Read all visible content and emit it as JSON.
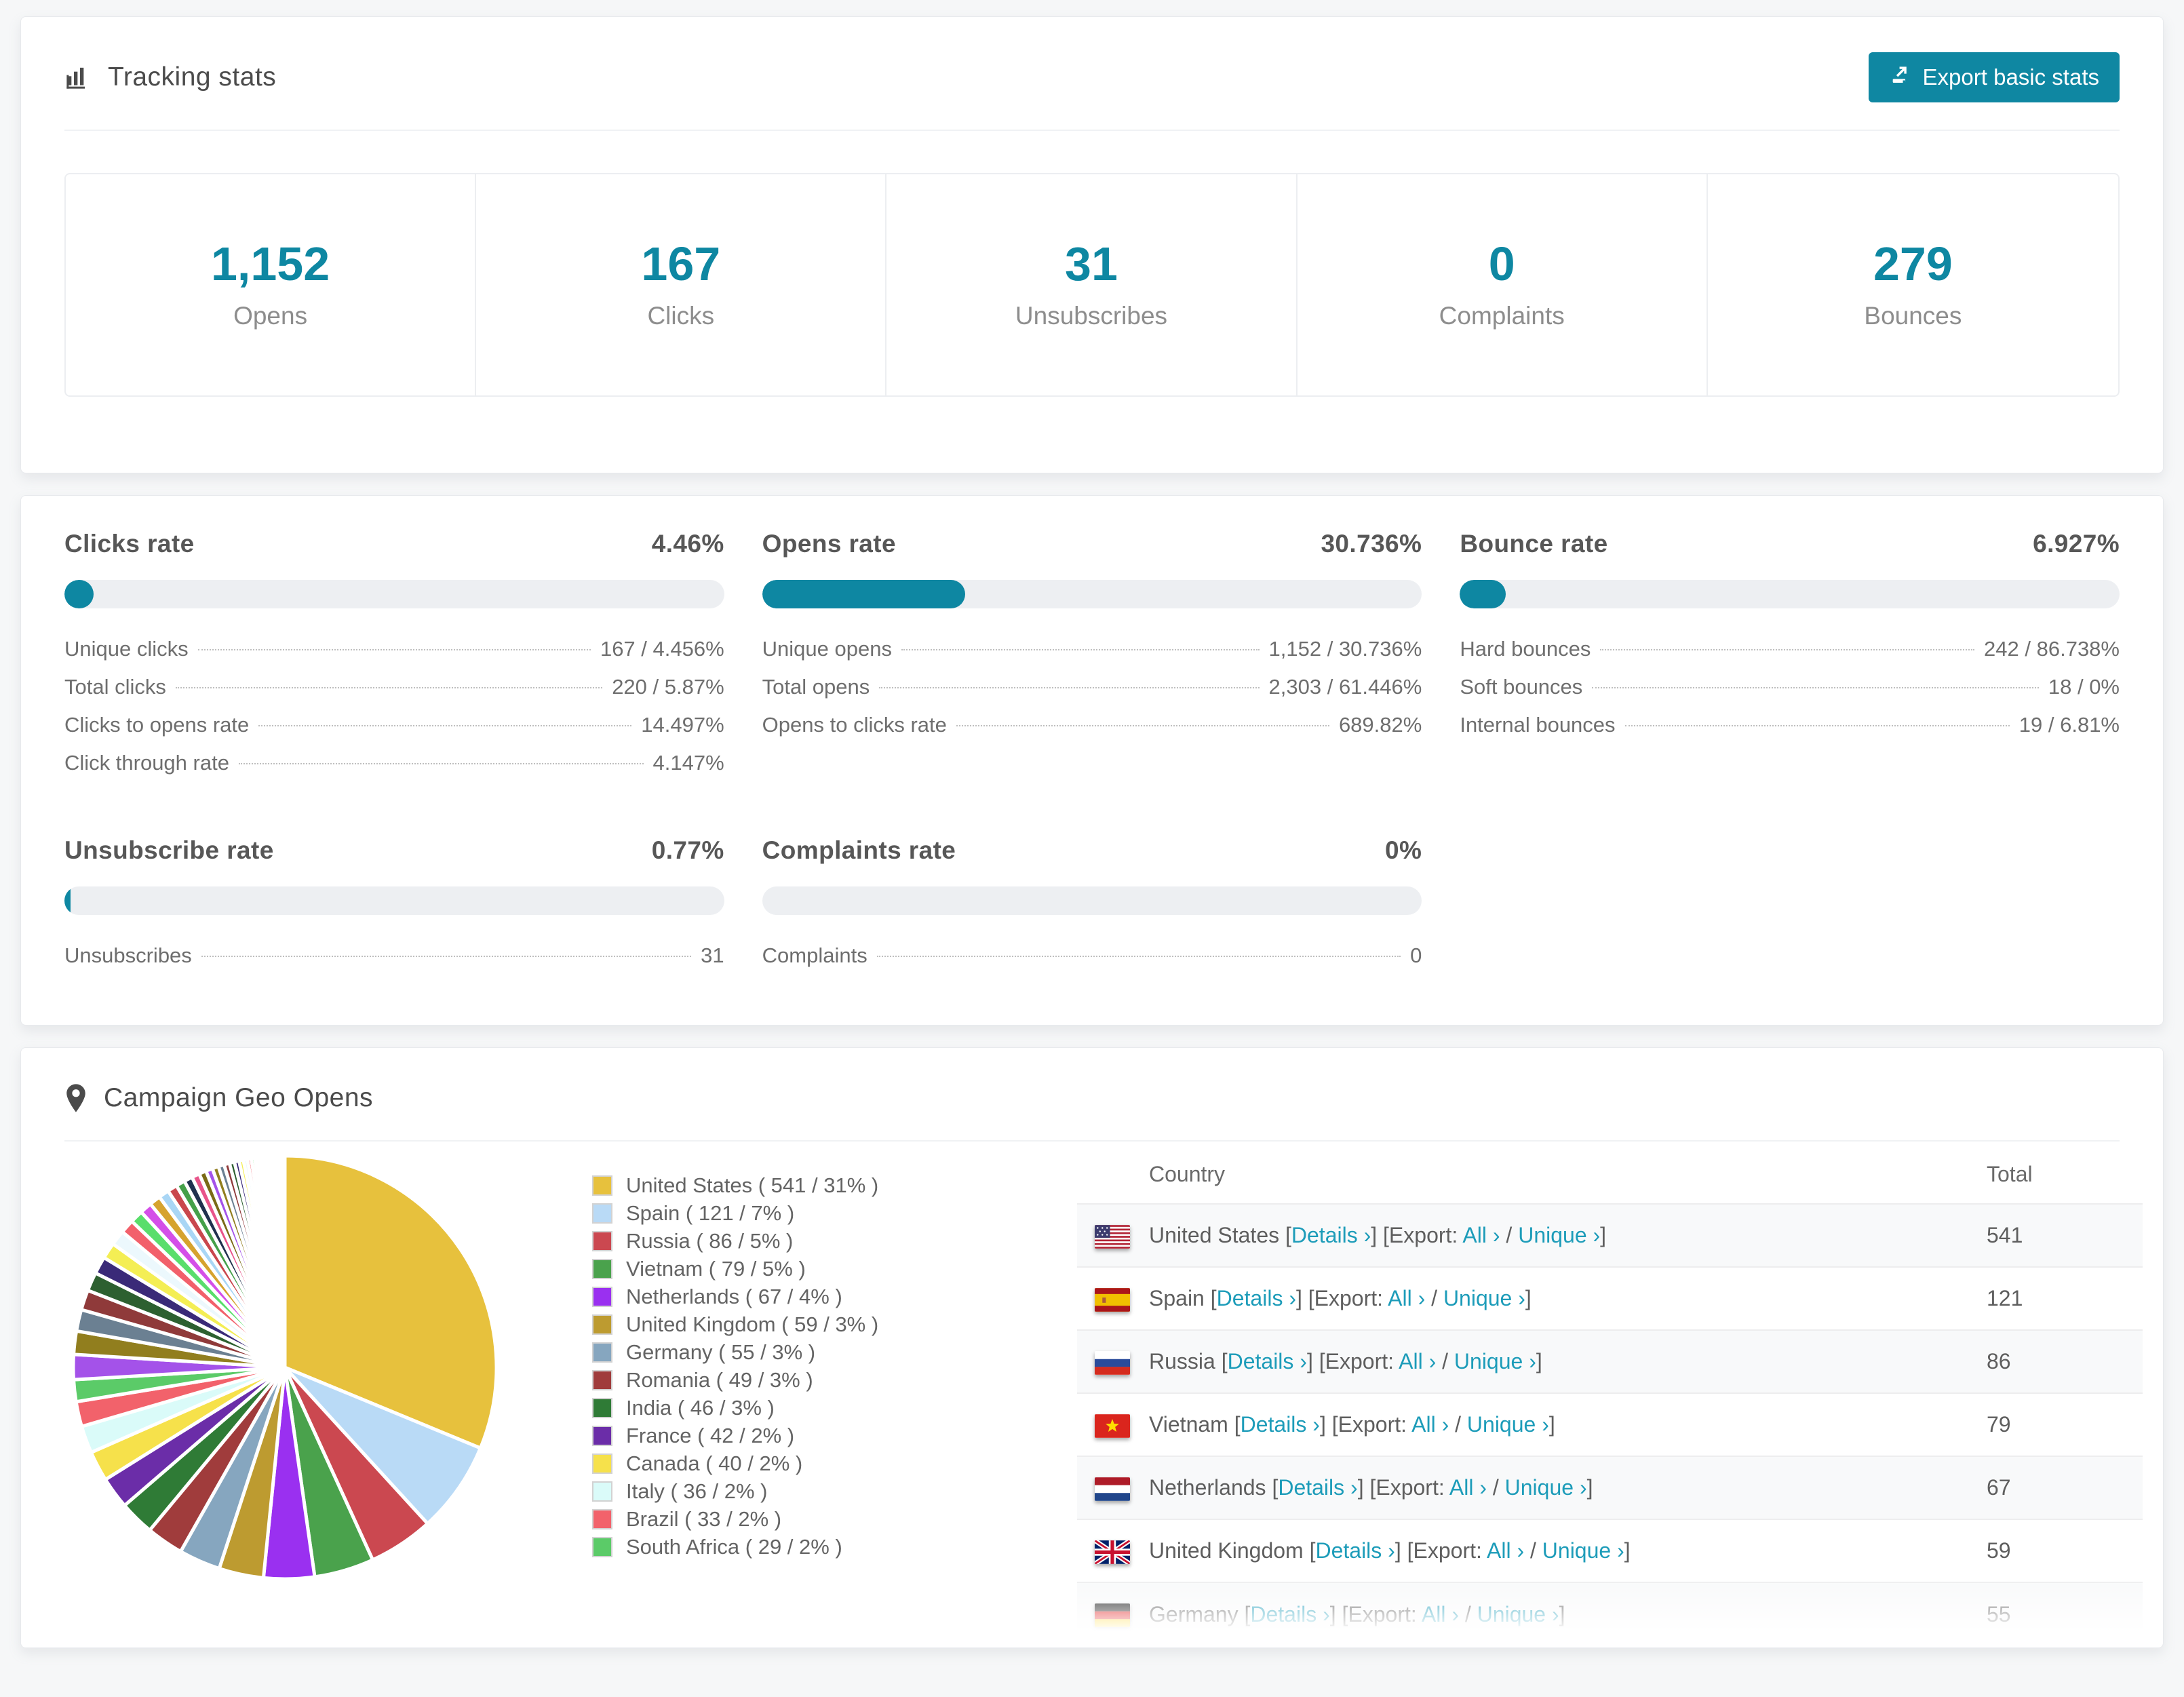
{
  "colors": {
    "accent": "#0e87a2",
    "link": "#1d9cb9"
  },
  "tracking": {
    "title": "Tracking stats",
    "export_button": "Export basic stats",
    "summary": [
      {
        "value": "1,152",
        "label": "Opens"
      },
      {
        "value": "167",
        "label": "Clicks"
      },
      {
        "value": "31",
        "label": "Unsubscribes"
      },
      {
        "value": "0",
        "label": "Complaints"
      },
      {
        "value": "279",
        "label": "Bounces"
      }
    ]
  },
  "rates": [
    {
      "title": "Clicks rate",
      "value": "4.46%",
      "percent": 4.46,
      "rows": [
        {
          "label": "Unique clicks",
          "value": "167 / 4.456%"
        },
        {
          "label": "Total clicks",
          "value": "220 / 5.87%"
        },
        {
          "label": "Clicks to opens rate",
          "value": "14.497%"
        },
        {
          "label": "Click through rate",
          "value": "4.147%"
        }
      ]
    },
    {
      "title": "Opens rate",
      "value": "30.736%",
      "percent": 30.736,
      "rows": [
        {
          "label": "Unique opens",
          "value": "1,152 / 30.736%"
        },
        {
          "label": "Total opens",
          "value": "2,303 / 61.446%"
        },
        {
          "label": "Opens to clicks rate",
          "value": "689.82%"
        }
      ]
    },
    {
      "title": "Bounce rate",
      "value": "6.927%",
      "percent": 6.927,
      "rows": [
        {
          "label": "Hard bounces",
          "value": "242 / 86.738%"
        },
        {
          "label": "Soft bounces",
          "value": "18 / 0%"
        },
        {
          "label": "Internal bounces",
          "value": "19 / 6.81%"
        }
      ]
    },
    {
      "title": "Unsubscribe rate",
      "value": "0.77%",
      "percent": 0.77,
      "rows": [
        {
          "label": "Unsubscribes",
          "value": "31"
        }
      ]
    },
    {
      "title": "Complaints rate",
      "value": "0%",
      "percent": 0,
      "rows": [
        {
          "label": "Complaints",
          "value": "0"
        }
      ]
    }
  ],
  "geo": {
    "title": "Campaign Geo Opens",
    "legend": [
      {
        "label": "United States ( 541 / 31% )",
        "color": "#e7c13d"
      },
      {
        "label": "Spain ( 121 / 7% )",
        "color": "#b9daf6"
      },
      {
        "label": "Russia ( 86 / 5% )",
        "color": "#cb4850"
      },
      {
        "label": "Vietnam ( 79 / 5% )",
        "color": "#4aa24c"
      },
      {
        "label": "Netherlands ( 67 / 4% )",
        "color": "#9a30f0"
      },
      {
        "label": "United Kingdom ( 59 / 3% )",
        "color": "#bd9b30"
      },
      {
        "label": "Germany ( 55 / 3% )",
        "color": "#86a6bf"
      },
      {
        "label": "Romania ( 49 / 3% )",
        "color": "#a03c3c"
      },
      {
        "label": "India ( 46 / 3% )",
        "color": "#2f7b36"
      },
      {
        "label": "France ( 42 / 2% )",
        "color": "#6b2da8"
      },
      {
        "label": "Canada ( 40 / 2% )",
        "color": "#f6e14b"
      },
      {
        "label": "Italy ( 36 / 2% )",
        "color": "#dafbf9"
      },
      {
        "label": "Brazil ( 33 / 2% )",
        "color": "#f2626b"
      },
      {
        "label": "South Africa ( 29 / 2% )",
        "color": "#5bcb68"
      }
    ],
    "table": {
      "headers": {
        "country": "Country",
        "total": "Total"
      },
      "links": {
        "bracket_open": "[",
        "bracket_close": "]",
        "details": "Details ›",
        "export_prefix": "[Export:",
        "all": "All ›",
        "separator": "/",
        "unique": "Unique ›"
      },
      "rows": [
        {
          "flag": "us",
          "country": "United States",
          "total": "541"
        },
        {
          "flag": "es",
          "country": "Spain",
          "total": "121"
        },
        {
          "flag": "ru",
          "country": "Russia",
          "total": "86"
        },
        {
          "flag": "vn",
          "country": "Vietnam",
          "total": "79"
        },
        {
          "flag": "nl",
          "country": "Netherlands",
          "total": "67"
        },
        {
          "flag": "gb",
          "country": "United Kingdom",
          "total": "59"
        },
        {
          "flag": "de",
          "country": "Germany",
          "total": "55"
        }
      ]
    }
  },
  "chart_data": {
    "type": "pie",
    "title": "Campaign Geo Opens",
    "unit": "opens",
    "labels": [
      "United States",
      "Spain",
      "Russia",
      "Vietnam",
      "Netherlands",
      "United Kingdom",
      "Germany",
      "Romania",
      "India",
      "France",
      "Canada",
      "Italy",
      "Brazil",
      "South Africa"
    ],
    "values": [
      541,
      121,
      86,
      79,
      67,
      59,
      55,
      49,
      46,
      42,
      40,
      36,
      33,
      29
    ],
    "percents": [
      31,
      7,
      5,
      5,
      4,
      3,
      3,
      3,
      3,
      2,
      2,
      2,
      2,
      2
    ],
    "colors": [
      "#e7c13d",
      "#b9daf6",
      "#cb4850",
      "#4aa24c",
      "#9a30f0",
      "#bd9b30",
      "#86a6bf",
      "#a03c3c",
      "#2f7b36",
      "#6b2da8",
      "#f6e14b",
      "#dafbf9",
      "#f2626b",
      "#5bcb68"
    ],
    "other_small_slices": {
      "note": "long tail of unlabeled small countries (~26% of pie)",
      "approx_total_value": 449,
      "render": {
        "count": 42,
        "first_value": 33,
        "decay": 0.93
      },
      "palette": [
        "#a452e9",
        "#917e1e",
        "#6b8092",
        "#8f3a3a",
        "#2d6030",
        "#3a2a78",
        "#f4ee54",
        "#ecf8fd",
        "#f2606b",
        "#59de6b",
        "#d44fe8",
        "#d6a32e",
        "#a9d6f5",
        "#c9474d",
        "#45a049",
        "#20314e",
        "#e8548a",
        "#7a6a16"
      ]
    },
    "legend_position": "right",
    "start_angle_deg": -90,
    "direction": "clockwise",
    "slice_gap_stroke": "#ffffff"
  }
}
